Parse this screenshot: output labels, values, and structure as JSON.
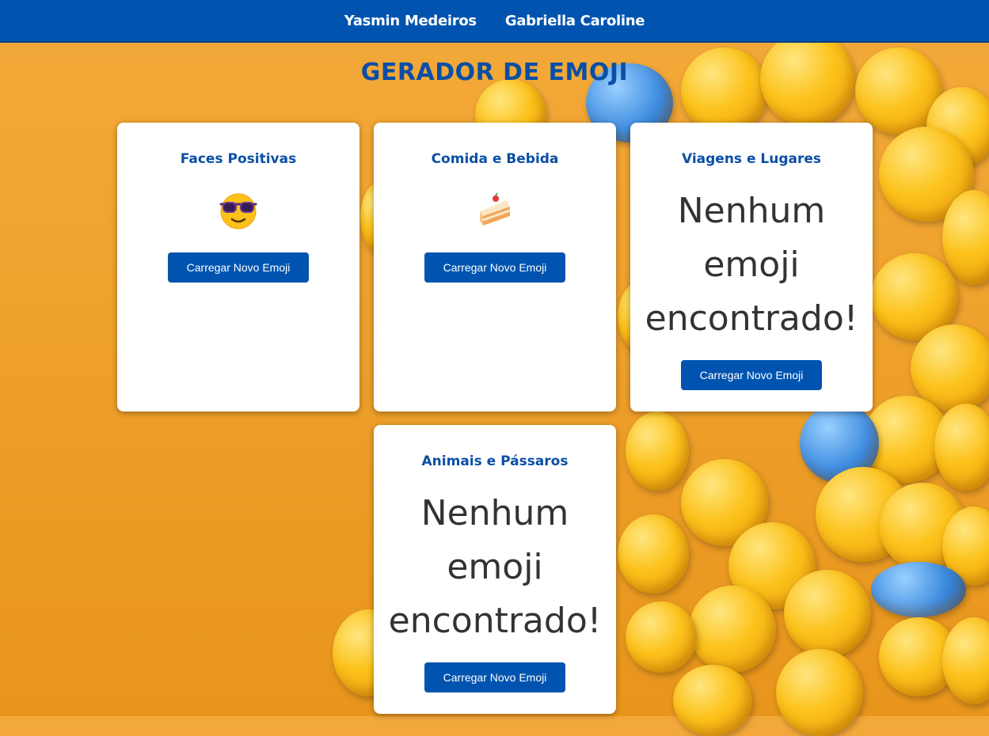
{
  "nav": {
    "link1": "Yasmin Medeiros",
    "link2": "Gabriella Caroline"
  },
  "page_title": "GERADOR DE EMOJI",
  "cards": [
    {
      "title": "Faces Positivas",
      "emoji": "smiling-face-with-sunglasses",
      "button_label": "Carregar Novo Emoji"
    },
    {
      "title": "Comida e Bebida",
      "emoji": "shortcake",
      "button_label": "Carregar Novo Emoji"
    },
    {
      "title": "Viagens e Lugares",
      "message_line1": "Nenhum",
      "message_line2": "emoji",
      "message_line3": "encontrado!",
      "button_label": "Carregar Novo Emoji"
    },
    {
      "title": "Animais e Pássaros",
      "message_line1": "Nenhum",
      "message_line2": "emoji",
      "message_line3": "encontrado!",
      "button_label": "Carregar Novo Emoji"
    }
  ],
  "colors": {
    "primary": "#0054b0",
    "title": "#0a4fa6",
    "background": "#eea02b"
  }
}
